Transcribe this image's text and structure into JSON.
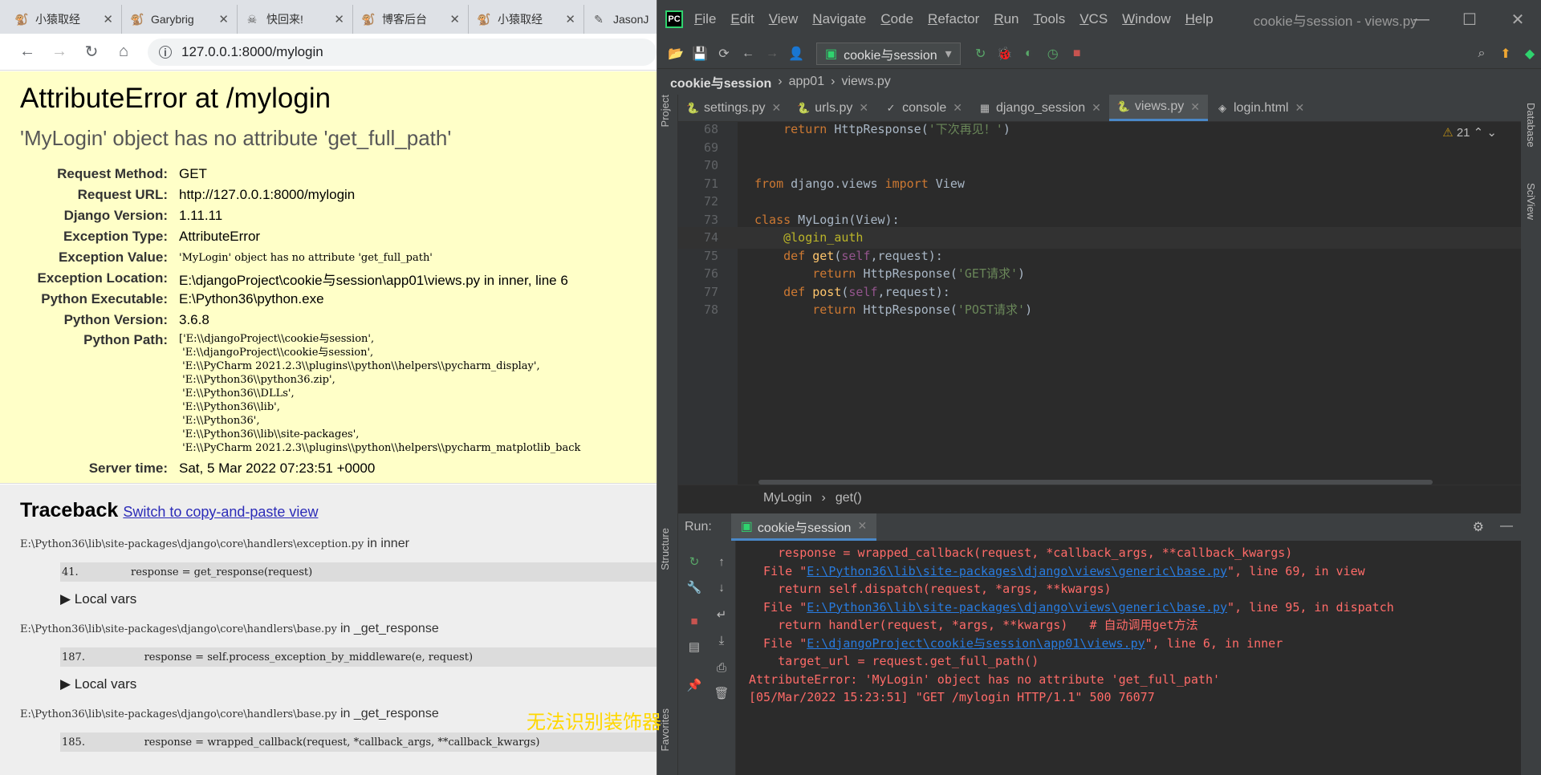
{
  "browser": {
    "tabs": [
      {
        "label": "小猿取经",
        "icon": "ape-favicon"
      },
      {
        "label": "Garybrig",
        "icon": "ape-favicon"
      },
      {
        "label": "快回来!",
        "icon": "skull-favicon"
      },
      {
        "label": "博客后台",
        "icon": "ape-favicon"
      },
      {
        "label": "小猿取经",
        "icon": "ape-favicon"
      },
      {
        "label": "JasonJ",
        "icon": "blog-favicon"
      }
    ],
    "url": "127.0.0.1:8000/mylogin"
  },
  "error": {
    "title": "AttributeError at /mylogin",
    "subtitle": "'MyLogin' object has no attribute 'get_full_path'",
    "meta": [
      {
        "key": "Request Method:",
        "value": "GET"
      },
      {
        "key": "Request URL:",
        "value": "http://127.0.0.1:8000/mylogin"
      },
      {
        "key": "Django Version:",
        "value": "1.11.11"
      },
      {
        "key": "Exception Type:",
        "value": "AttributeError"
      },
      {
        "key": "Exception Value:",
        "value": "'MyLogin' object has no attribute 'get_full_path'"
      },
      {
        "key": "Exception Location:",
        "value": "E:\\djangoProject\\cookie与session\\app01\\views.py in inner, line 6"
      },
      {
        "key": "Python Executable:",
        "value": "E:\\Python36\\python.exe"
      },
      {
        "key": "Python Version:",
        "value": "3.6.8"
      }
    ],
    "python_path_label": "Python Path:",
    "python_path": [
      "['E:\\\\djangoProject\\\\cookie与session',",
      " 'E:\\\\djangoProject\\\\cookie与session',",
      " 'E:\\\\PyCharm 2021.2.3\\\\plugins\\\\python\\\\helpers\\\\pycharm_display',",
      " 'E:\\\\Python36\\\\python36.zip',",
      " 'E:\\\\Python36\\\\DLLs',",
      " 'E:\\\\Python36\\\\lib',",
      " 'E:\\\\Python36',",
      " 'E:\\\\Python36\\\\lib\\\\site-packages',",
      " 'E:\\\\PyCharm 2021.2.3\\\\plugins\\\\python\\\\helpers\\\\pycharm_matplotlib_back"
    ],
    "server_time_label": "Server time:",
    "server_time": "Sat, 5 Mar 2022 07:23:51 +0000"
  },
  "traceback": {
    "heading": "Traceback",
    "switch_link": "Switch to copy-and-paste view",
    "in_word": "in",
    "frames": [
      {
        "path": "E:\\Python36\\lib\\site-packages\\django\\core\\handlers\\exception.py",
        "func": "inner",
        "line_no": "41.",
        "code": "response = get_response(request)",
        "vars": "Local vars"
      },
      {
        "path": "E:\\Python36\\lib\\site-packages\\django\\core\\handlers\\base.py",
        "func": "_get_response",
        "line_no": "187.",
        "code": "    response = self.process_exception_by_middleware(e, request)",
        "vars": "Local vars"
      },
      {
        "path": "E:\\Python36\\lib\\site-packages\\django\\core\\handlers\\base.py",
        "func": "_get_response",
        "line_no": "185.",
        "code": "    response = wrapped_callback(request, *callback_args, **callback_kwargs)",
        "vars": ""
      }
    ]
  },
  "ide": {
    "menu": [
      "File",
      "Edit",
      "View",
      "Navigate",
      "Code",
      "Refactor",
      "Run",
      "Tools",
      "VCS",
      "Window",
      "Help"
    ],
    "window_title": "cookie与session - views.py",
    "run_config": "cookie与session",
    "breadcrumbs": [
      "cookie与session",
      "app01",
      "views.py"
    ],
    "editor_tabs": [
      {
        "label": "settings.py",
        "icon": "python-file-icon",
        "active": false
      },
      {
        "label": "urls.py",
        "icon": "python-file-icon",
        "active": false
      },
      {
        "label": "console",
        "icon": "console-icon",
        "active": false
      },
      {
        "label": "django_session",
        "icon": "table-icon",
        "active": false
      },
      {
        "label": "views.py",
        "icon": "python-file-icon",
        "active": true
      },
      {
        "label": "login.html",
        "icon": "html-file-icon",
        "active": false
      }
    ],
    "warnings_count": "21",
    "code_lines": [
      {
        "n": "68",
        "html": "    <span class=\"kw\">return</span> HttpResponse(<span class=\"st\">'下次再见！'</span>)"
      },
      {
        "n": "69",
        "html": ""
      },
      {
        "n": "70",
        "html": ""
      },
      {
        "n": "71",
        "html": "<span class=\"kw\">from</span> django.views <span class=\"kw\">import</span> View"
      },
      {
        "n": "72",
        "html": ""
      },
      {
        "n": "73",
        "html": "<span class=\"kw\">class</span> MyLogin(View):"
      },
      {
        "n": "74",
        "html": "    <span class=\"dec\">@login_auth</span>"
      },
      {
        "n": "75",
        "html": "    <span class=\"kw\">def</span> <span class=\"fn\">get</span>(<span class=\"slf\">self</span>,request):"
      },
      {
        "n": "76",
        "html": "        <span class=\"kw\">return</span> HttpResponse(<span class=\"st\">'GET请求'</span>)"
      },
      {
        "n": "77",
        "html": "    <span class=\"kw\">def</span> <span class=\"fn\">post</span>(<span class=\"slf\">self</span>,request):"
      },
      {
        "n": "78",
        "html": "        <span class=\"kw\">return</span> HttpResponse(<span class=\"st\">'POST请求'</span>)"
      }
    ],
    "editor_crumbs": [
      "MyLogin",
      "get()"
    ],
    "run_label": "Run:",
    "run_tab": "cookie与session",
    "console_lines": [
      {
        "html": "    response = wrapped_callback(request, *callback_args, **callback_kwargs)"
      },
      {
        "html": "  File \"<a>E:\\Python36\\lib\\site-packages\\django\\views\\generic\\base.py</a>\", line 69, in view"
      },
      {
        "html": "    return self.dispatch(request, *args, **kwargs)"
      },
      {
        "html": "  File \"<a>E:\\Python36\\lib\\site-packages\\django\\views\\generic\\base.py</a>\", line 95, in dispatch"
      },
      {
        "html": "    return handler(request, *args, **kwargs)   # 自动调用get方法"
      },
      {
        "html": "  File \"<a>E:\\djangoProject\\cookie与session\\app01\\views.py</a>\", line 6, in inner"
      },
      {
        "html": "    target_url = request.get_full_path()"
      },
      {
        "html": "AttributeError: 'MyLogin' object has no attribute 'get_full_path'"
      },
      {
        "html": "[05/Mar/2022 15:23:51] \"GET /mylogin HTTP/1.1\" 500 76077"
      }
    ],
    "annotation": "无法识别装饰器",
    "side_tabs_left": [
      "Project",
      "Structure",
      "Favorites"
    ],
    "side_tabs_right": [
      "Database",
      "SciView"
    ]
  }
}
